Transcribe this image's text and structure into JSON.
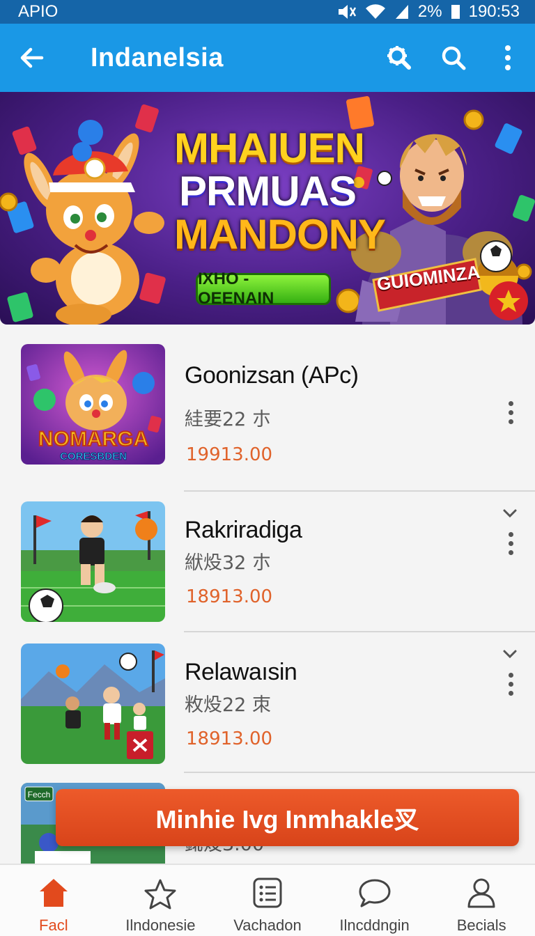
{
  "status_bar": {
    "left_text": "APIO",
    "battery_text": "2%",
    "time": "190:53"
  },
  "app_bar": {
    "title": "Indanelsia",
    "icons": [
      "back-arrow-icon",
      "gear-search-icon",
      "search-icon",
      "more-vertical-icon"
    ]
  },
  "banner": {
    "title_lines": [
      "MHAIUEN",
      "PRMUAS",
      "MANDONY"
    ],
    "button_label": "IXHO - OEENAIN",
    "ribbon_text": "GUIOMINZA"
  },
  "games": [
    {
      "name": "Goonizsan (APc)",
      "meta": "絓要22 朩",
      "price": "19913.00",
      "has_chevron": false
    },
    {
      "name": "Rakriradiga",
      "meta": "絥炈32 朩",
      "price": "18913.00",
      "has_chevron": true
    },
    {
      "name": "Relawaısin",
      "meta": "敉炈22 朿",
      "price": "18913.00",
      "has_chevron": true
    },
    {
      "name": "",
      "meta": "",
      "price": "",
      "partial_text": "鉳炈3.00"
    }
  ],
  "thumb_texts": {
    "game1_logo_top": "NOMARGA",
    "game1_logo_bottom": "CORESBDEN",
    "game4_badge": "Fecch"
  },
  "install_button": {
    "label": "Minhie Ivg Inmhakle㕚"
  },
  "bottom_nav": [
    {
      "label": "Facl",
      "icon": "home-icon",
      "active": true
    },
    {
      "label": "Ilndonesie",
      "icon": "star-icon",
      "active": false
    },
    {
      "label": "Vachadon",
      "icon": "list-icon",
      "active": false
    },
    {
      "label": "Ilncddngin",
      "icon": "chat-bubble-icon",
      "active": false
    },
    {
      "label": "Becials",
      "icon": "person-icon",
      "active": false
    }
  ],
  "colors": {
    "status_bar": "#1565a8",
    "app_bar": "#1a98e6",
    "accent": "#e24a1d",
    "price": "#e0622a"
  }
}
